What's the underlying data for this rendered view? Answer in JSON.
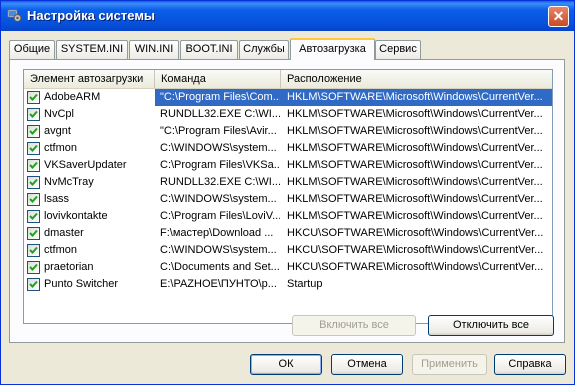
{
  "window": {
    "title": "Настройка системы",
    "close_label": "✕"
  },
  "tabs": [
    {
      "label": "Общие"
    },
    {
      "label": "SYSTEM.INI"
    },
    {
      "label": "WIN.INI"
    },
    {
      "label": "BOOT.INI"
    },
    {
      "label": "Службы"
    },
    {
      "label": "Автозагрузка"
    },
    {
      "label": "Сервис"
    }
  ],
  "active_tab": "Автозагрузка",
  "startup_list": {
    "columns": [
      "Элемент автозагрузки",
      "Команда",
      "Расположение"
    ],
    "rows": [
      {
        "item": "AdobeARM",
        "command": "\"C:\\Program Files\\Com...",
        "location": "HKLM\\SOFTWARE\\Microsoft\\Windows\\CurrentVer...",
        "checked": true,
        "selected": true
      },
      {
        "item": "NvCpl",
        "command": "RUNDLL32.EXE C:\\WI...",
        "location": "HKLM\\SOFTWARE\\Microsoft\\Windows\\CurrentVer...",
        "checked": true
      },
      {
        "item": "avgnt",
        "command": "\"C:\\Program Files\\Avir...",
        "location": "HKLM\\SOFTWARE\\Microsoft\\Windows\\CurrentVer...",
        "checked": true
      },
      {
        "item": "ctfmon",
        "command": "C:\\WINDOWS\\system...",
        "location": "HKLM\\SOFTWARE\\Microsoft\\Windows\\CurrentVer...",
        "checked": true
      },
      {
        "item": "VKSaverUpdater",
        "command": "C:\\Program Files\\VKSa...",
        "location": "HKLM\\SOFTWARE\\Microsoft\\Windows\\CurrentVer...",
        "checked": true
      },
      {
        "item": "NvMcTray",
        "command": "RUNDLL32.EXE C:\\WI...",
        "location": "HKLM\\SOFTWARE\\Microsoft\\Windows\\CurrentVer...",
        "checked": true
      },
      {
        "item": "lsass",
        "command": "C:\\WINDOWS\\system...",
        "location": "HKLM\\SOFTWARE\\Microsoft\\Windows\\CurrentVer...",
        "checked": true
      },
      {
        "item": "lovivkontakte",
        "command": "C:\\Program Files\\LoviV...",
        "location": "HKLM\\SOFTWARE\\Microsoft\\Windows\\CurrentVer...",
        "checked": true
      },
      {
        "item": "dmaster",
        "command": "F:\\мастер\\Download ...",
        "location": "HKCU\\SOFTWARE\\Microsoft\\Windows\\CurrentVer...",
        "checked": true
      },
      {
        "item": "ctfmon",
        "command": "C:\\WINDOWS\\system...",
        "location": "HKCU\\SOFTWARE\\Microsoft\\Windows\\CurrentVer...",
        "checked": true
      },
      {
        "item": "praetorian",
        "command": "C:\\Documents and Set...",
        "location": "HKCU\\SOFTWARE\\Microsoft\\Windows\\CurrentVer...",
        "checked": true
      },
      {
        "item": "Punto Switcher",
        "command": "E:\\PAZHOE\\ПУНТО\\p...",
        "location": "Startup",
        "checked": true
      }
    ]
  },
  "buttons": {
    "enable_all": "Включить все",
    "disable_all": "Отключить все",
    "ok": "ОК",
    "cancel": "Отмена",
    "apply": "Применить",
    "help": "Справка"
  }
}
